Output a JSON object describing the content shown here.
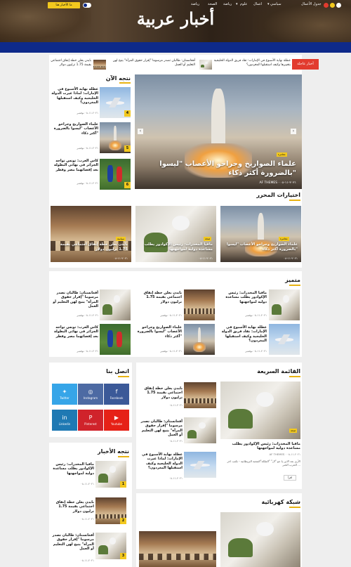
{
  "site": {
    "title": "أخبار عربية"
  },
  "nav": {
    "items": [
      {
        "label": "جدول الأعمال"
      },
      {
        "label": "سياسي",
        "chevron": "▾"
      },
      {
        "label": "اعمال"
      },
      {
        "label": "علوم",
        "chevron": "▾"
      },
      {
        "label": "رياضة"
      },
      {
        "label": "الصحة"
      },
      {
        "label": "رياضة"
      }
    ],
    "cta_label": "ما الأخبار هنا"
  },
  "ticker": {
    "badge": "أخبار عاجلة",
    "items": [
      {
        "text": "مافيا المخدرات: رئيس الإكوادور يطلب مساعدة دولية لمواجهتها"
      },
      {
        "text": "عطلة نهاية الأسبوع في الإمارات: تقاد فريق الدولة الخليجية بتغييرها وكيف استقبلها المغردون؟"
      },
      {
        "text": "أفغانستان: طالبان تصدر مرسوما \"إقرار حقوق المرأة\" يتيح لهن التعليم أو العمل"
      },
      {
        "text": "بايدن يعلن خطة إنفاق اجتماعي بقيمة 1.75 ترليون دولار"
      }
    ]
  },
  "now": {
    "title": "نتجه الآن",
    "items": [
      {
        "title": "عطلة نهاية الأسبوع في الإمارات: لماذا غيرت الدولة الخليجية وكيف استقبلها المغردون؟",
        "num": "4",
        "date": "٢٠٢١-١١-٠٨ نوفمبر"
      },
      {
        "title": "علماء الصواريخ وجراحو الأعصاب \"ليسوا بالضرورة أكثر ذكاء\"",
        "num": "5",
        "date": "٢٠٢١-١١-٠٨ نوفمبر"
      },
      {
        "title": "كاس العرب: تونس تواجه الجزائر في نهائي البطولة بعد إقصائهما مصر وقطر",
        "num": "6",
        "date": "٢٠٢١-١١-٠٨ نوفمبر"
      }
    ]
  },
  "hero": {
    "title": "علماء الصواريخ وجراحو الأعصاب \"ليسوا بالضرورة أكثر ذكاء\"",
    "category": "مغامرة",
    "date": "٢٠٢١-١١-٠٨",
    "author": "AF THEMES"
  },
  "editors": {
    "title": "اختيارات المحرر",
    "items": [
      {
        "title": "علماء الصواريخ وجراحو الأعصاب \"ليسوا بالضرورة أكثر ذكاء\"",
        "category": "مغامرة",
        "date": "٢٠٢١-١١-٠٨"
      },
      {
        "title": "مافيا المخدرات: رئيس الإكوادور يطلب مساعدة دولية لمواجهتها",
        "category": "صحة",
        "date": "٢٠٢١-١١-٠٨"
      },
      {
        "title": "بايدن يعلن خطة إنفاق اجتماعي بقيمة 1.75 ترليون دولار",
        "category": "سياسة",
        "date": "٢٠٢١-١١-٠٨"
      }
    ]
  },
  "trending": {
    "title": "متميز",
    "items": [
      {
        "title": "مافيا المخدرات: رئيس الإكوادور يطلب مساعدة دولية لمواجهتها",
        "date": "٢٠٢١-١١-٠٨ نوفمبر"
      },
      {
        "title": "بايدن يعلن خطة إنفاق اجتماعي بقيمة 1.75 ترليون دولار",
        "date": "٢٠٢١-١١-٠٨ نوفمبر"
      },
      {
        "title": "أفغانستان: طالبان تصدر مرسوما \"إقرار حقوق المرأة\" يتيح لهن التعليم أو العمل",
        "date": "٢٠٢١-١١-٠٨ نوفمبر"
      },
      {
        "title": "عطلة نهاية الأسبوع في الإمارات: تقاد فريق الدولة الخليجية وكيف استقبلها المغردون؟",
        "date": "٢٠٢١-١١-٠٨ نوفمبر"
      },
      {
        "title": "علماء الصواريخ وجراحو الأعصاب \"ليسوا بالضرورة أكثر ذكاء\"",
        "date": "٢٠٢١-١١-٠٨ نوفمبر"
      },
      {
        "title": "كاس العرب: تونس تواجه الجزائر في نهائي البطولة بعد إقصائهما مصر وقطر",
        "date": "٢٠٢١-١١-٠٨ نوفمبر"
      }
    ]
  },
  "quick": {
    "title": "القائمة السريعة",
    "lead": {
      "title": "مافيا المخدرات: رئيس الإكوادور يطلب مساعدة دولية لمواجهتها",
      "category": "صحة",
      "date": "٢٠٢١-١١-٠٨",
      "author": "AF THEMES",
      "excerpt": "الأرى بعد الابن يا جو \"ال\" \"الملكة\"المجبة البريطانية - نكتب اخر الحرب الخبر ...",
      "more": "اقرأ"
    },
    "items": [
      {
        "title": "بايدن يعلن خطة إنفاق اجتماعي بقيمة 1.75 ترليون دولار",
        "date": "٢٠٢١-١١-٠٨"
      },
      {
        "title": "أفغانستان: طالبان تصدر مرسوما \"إقرار حقوق المرأة\" يتيح لهن التعليم أو العمل",
        "date": "٢٠٢١-١١-٠٨"
      },
      {
        "title": "عطلة نهاية الأسبوع في الإمارات: لماذا غيرت الدولة الخليجية وكيف استقبلها المغردون؟",
        "date": "٢٠٢١-١١-٠٨"
      }
    ]
  },
  "social": {
    "title": "اتصل بنا",
    "items": [
      {
        "label": "Facebook",
        "glyph": "f",
        "color": "#3b5998"
      },
      {
        "label": "Instagram",
        "glyph": "◎",
        "color": "#4d6aa3"
      },
      {
        "label": "Twitter",
        "glyph": "✦",
        "color": "#36a5e8"
      },
      {
        "label": "Youtube",
        "glyph": "▶",
        "color": "#e62117"
      },
      {
        "label": "Pinterest",
        "glyph": "P",
        "color": "#d0232b"
      },
      {
        "label": "Linkedin",
        "glyph": "in",
        "color": "#1f79b3"
      }
    ]
  },
  "news_side": {
    "title": "نتجه الأخبار",
    "items": [
      {
        "title": "مافيا المخدرات: رئيس الإكوادور يطلب مساعدة دولية لمواجهتها",
        "num": "1",
        "date": "٢٠٢١-١١-٠٨"
      },
      {
        "title": "بايدن يعلن خطة إنفاق اجتماعي بقيمة 1.75 ترليون دولار",
        "num": "2",
        "date": "٢٠٢١-١١-٠٨"
      },
      {
        "title": "أفغانستان: طالبان تصدر مرسوما \"إقرار حقوق المرأة\" يتيح لهن التعليم أو العمل",
        "num": "3",
        "date": "٢٠٢١-١١-٠٨"
      }
    ]
  },
  "electric": {
    "title": "شبكة كهربائية"
  }
}
